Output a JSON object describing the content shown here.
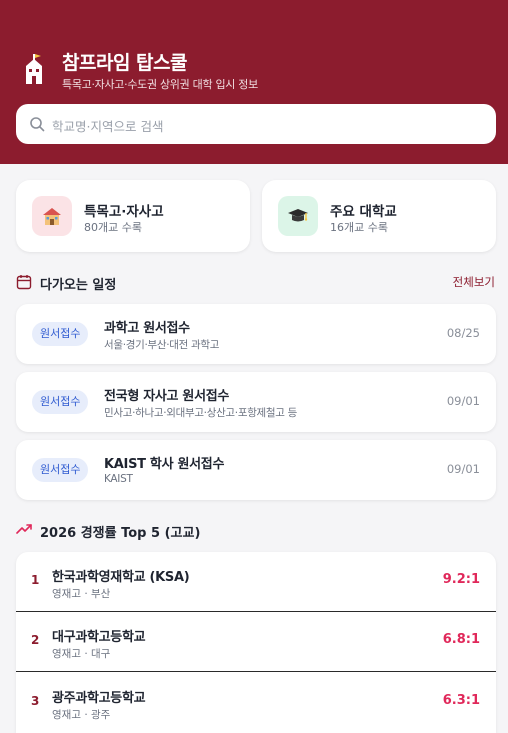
{
  "header": {
    "title": "참프라임 탑스쿨",
    "subtitle": "특목고·자사고·수도권 상위권 대학 입시 정보",
    "logo_icon": "school-building-icon"
  },
  "search": {
    "placeholder": "학교명·지역으로 검색",
    "icon": "search-icon"
  },
  "categories": [
    {
      "title": "특목고·자사고",
      "count": "80개교 수록",
      "icon": "school-house-icon",
      "bg": "#fbe3e6"
    },
    {
      "title": "주요 대학교",
      "count": "16개교 수록",
      "icon": "graduation-cap-icon",
      "bg": "#dcf5e8"
    }
  ],
  "schedule": {
    "heading": "다가오는 일정",
    "see_all": "전체보기",
    "items": [
      {
        "badge": "원서접수",
        "title": "과학고 원서접수",
        "desc": "서울·경기·부산·대전 과학고",
        "date": "08/25"
      },
      {
        "badge": "원서접수",
        "title": "전국형 자사고 원서접수",
        "desc": "민사고·하나고·외대부고·상산고·포항제철고 등",
        "date": "09/01"
      },
      {
        "badge": "원서접수",
        "title": "KAIST 학사 원서접수",
        "desc": "KAIST",
        "date": "09/01"
      }
    ]
  },
  "ranking": {
    "heading": "2026 경쟁률 Top 5 (고교)",
    "items": [
      {
        "rank": "1",
        "name": "한국과학영재학교 (KSA)",
        "desc": "영재고 · 부산",
        "ratio": "9.2:1"
      },
      {
        "rank": "2",
        "name": "대구과학고등학교",
        "desc": "영재고 · 대구",
        "ratio": "6.8:1"
      },
      {
        "rank": "3",
        "name": "광주과학고등학교",
        "desc": "영재고 · 광주",
        "ratio": "6.3:1"
      }
    ]
  },
  "colors": {
    "brand": "#8c1c2e",
    "accent": "#e0285a",
    "badge_bg": "#e7edfb",
    "badge_text": "#2f5bd1"
  }
}
